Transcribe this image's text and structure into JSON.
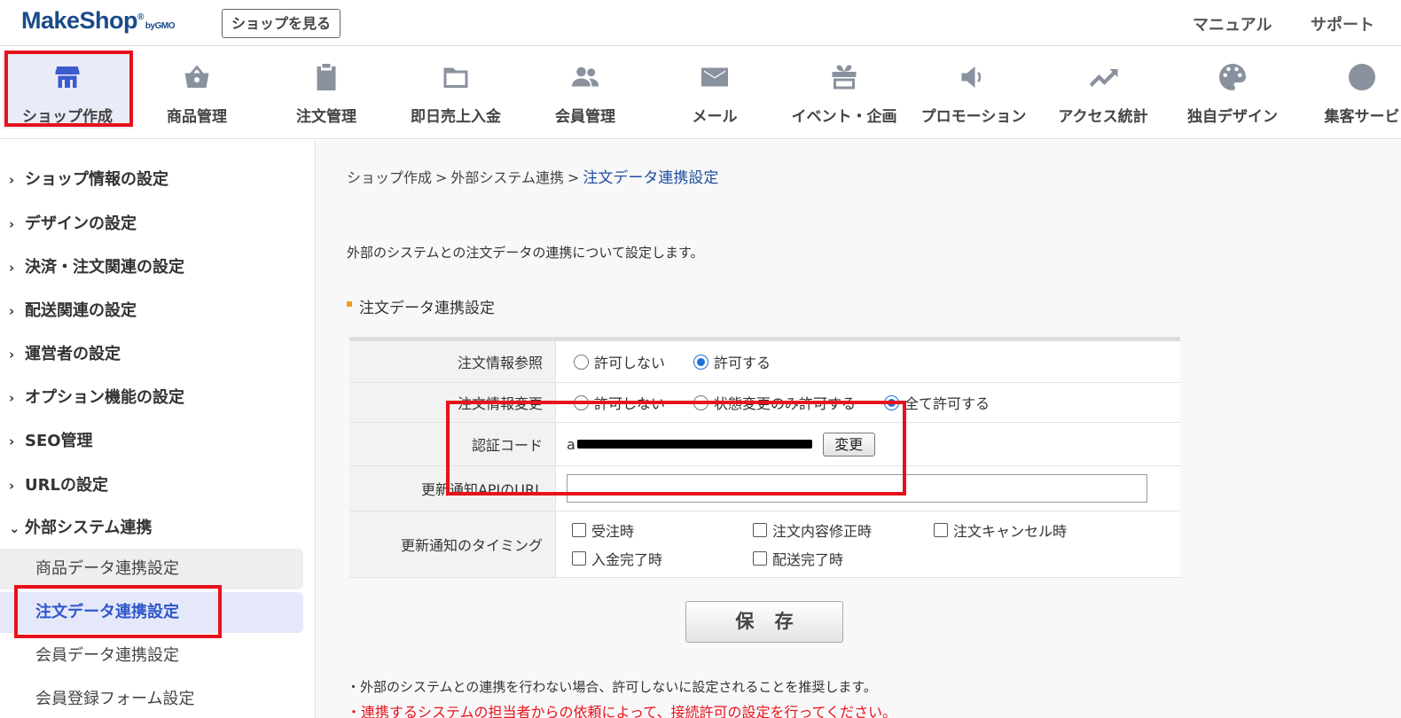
{
  "header": {
    "logo_make": "Make",
    "logo_shop": "Shop",
    "logo_reg": "®",
    "logo_by": "byGMO",
    "view_shop": "ショップを見る",
    "manual": "マニュアル",
    "support": "サポート"
  },
  "nav": {
    "items": [
      {
        "label": "ショップ作成",
        "icon": "store-icon",
        "active": true
      },
      {
        "label": "商品管理",
        "icon": "basket-icon"
      },
      {
        "label": "注文管理",
        "icon": "clipboard-icon"
      },
      {
        "label": "即日売上入金",
        "icon": "folder-icon"
      },
      {
        "label": "会員管理",
        "icon": "people-icon"
      },
      {
        "label": "メール",
        "icon": "mail-icon"
      },
      {
        "label": "イベント・企画",
        "icon": "gift-icon"
      },
      {
        "label": "プロモーション",
        "icon": "speaker-icon"
      },
      {
        "label": "アクセス統計",
        "icon": "trending-icon"
      },
      {
        "label": "独自デザイン",
        "icon": "palette-icon"
      },
      {
        "label": "集客サービ",
        "icon": "globe-icon"
      }
    ]
  },
  "sidebar": {
    "items": [
      {
        "label": "ショップ情報の設定",
        "chevron": "›"
      },
      {
        "label": "デザインの設定",
        "chevron": "›"
      },
      {
        "label": "決済・注文関連の設定",
        "chevron": "›"
      },
      {
        "label": "配送関連の設定",
        "chevron": "›"
      },
      {
        "label": "運営者の設定",
        "chevron": "›"
      },
      {
        "label": "オプション機能の設定",
        "chevron": "›"
      },
      {
        "label": "SEO管理",
        "chevron": "›"
      },
      {
        "label": "URLの設定",
        "chevron": "›"
      },
      {
        "label": "外部システム連携",
        "chevron": "⌄"
      }
    ],
    "sub_items": [
      "商品データ連携設定",
      "注文データ連携設定",
      "会員データ連携設定",
      "会員登録フォーム設定"
    ]
  },
  "main": {
    "breadcrumb": [
      "ショップ作成",
      "外部システム連携",
      "注文データ連携設定"
    ],
    "breadcrumb_sep": ">",
    "intro": "外部のシステムとの注文データの連携について設定します。",
    "section_title": "注文データ連携設定",
    "form": {
      "order_view": {
        "label": "注文情報参照",
        "options": [
          "許可しない",
          "許可する"
        ],
        "selected": "許可する"
      },
      "order_change": {
        "label": "注文情報変更",
        "options": [
          "許可しない",
          "状態変更のみ許可する",
          "全て許可する"
        ],
        "selected": "全て許可する"
      },
      "auth_code": {
        "label": "認証コード",
        "prefix": "a",
        "change_button": "変更"
      },
      "update_api_url": {
        "label": "更新通知APIのURL",
        "value": ""
      },
      "update_timing": {
        "label": "更新通知のタイミング",
        "options": [
          "受注時",
          "注文内容修正時",
          "注文キャンセル時",
          "入金完了時",
          "配送完了時"
        ]
      }
    },
    "save_button": "保 存",
    "note1": "・外部のシステムとの連携を行わない場合、許可しないに設定されることを推奨します。",
    "note2": "・連携するシステムの担当者からの依頼によって、接続許可の設定を行ってください。"
  },
  "colors": {
    "brand": "#1a4a8a",
    "active_nav": "#3a5ccf",
    "highlight_red": "#e8111b",
    "accent_orange": "#f39a1e"
  }
}
